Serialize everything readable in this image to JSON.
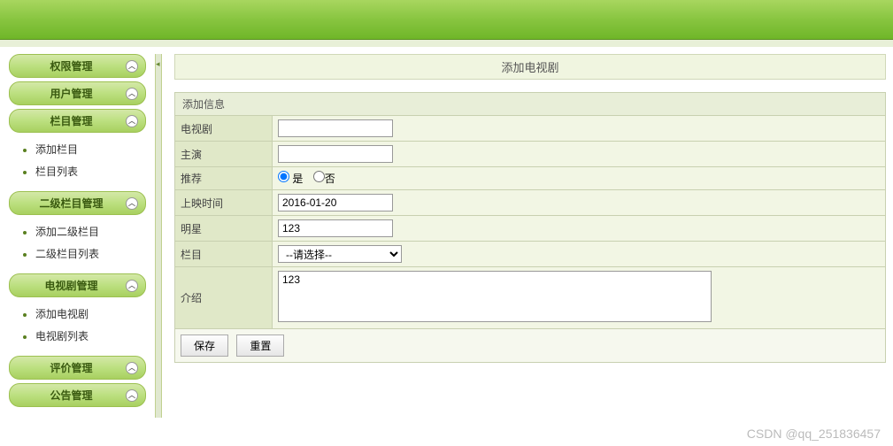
{
  "sidebar": {
    "sections": [
      {
        "title": "权限管理",
        "items": []
      },
      {
        "title": "用户管理",
        "items": []
      },
      {
        "title": "栏目管理",
        "items": [
          "添加栏目",
          "栏目列表"
        ]
      },
      {
        "title": "二级栏目管理",
        "items": [
          "添加二级栏目",
          "二级栏目列表"
        ]
      },
      {
        "title": "电视剧管理",
        "items": [
          "添加电视剧",
          "电视剧列表"
        ]
      },
      {
        "title": "评价管理",
        "items": []
      },
      {
        "title": "公告管理",
        "items": []
      }
    ]
  },
  "page": {
    "title": "添加电视剧",
    "fieldset_title": "添加信息"
  },
  "form": {
    "tvname": {
      "label": "电视剧",
      "value": ""
    },
    "actors": {
      "label": "主演",
      "value": ""
    },
    "recommend": {
      "label": "推荐",
      "yes": "是",
      "no": "否",
      "value": "yes"
    },
    "release": {
      "label": "上映时间",
      "value": "2016-01-20"
    },
    "stars": {
      "label": "明星",
      "value": "123"
    },
    "category": {
      "label": "栏目",
      "placeholder": "--请选择--"
    },
    "intro": {
      "label": "介绍",
      "value": "123"
    }
  },
  "buttons": {
    "save": "保存",
    "reset": "重置"
  },
  "watermark": "CSDN @qq_251836457"
}
